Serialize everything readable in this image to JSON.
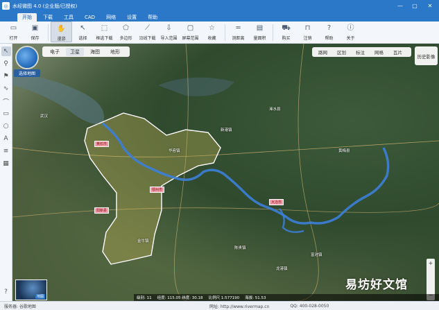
{
  "window": {
    "title": "水经微图 4.0 (企业版/已授权)",
    "controls": [
      "—",
      "▢",
      "✕"
    ]
  },
  "menus": [
    "开始",
    "下载",
    "工具",
    "CAD",
    "网络",
    "设置",
    "帮助"
  ],
  "toolbar": [
    {
      "label": "打开",
      "icon": "folder-icon"
    },
    {
      "label": "保存",
      "icon": "save-icon"
    },
    {
      "label": "漫游",
      "icon": "hand-icon"
    },
    {
      "label": "选择",
      "icon": "select-icon"
    },
    {
      "label": "框选下载",
      "icon": "box-download-icon"
    },
    {
      "label": "多边形",
      "icon": "polygon-icon"
    },
    {
      "label": "沿线下载",
      "icon": "line-download-icon"
    },
    {
      "label": "导入范围",
      "icon": "import-icon"
    },
    {
      "label": "屏幕范围",
      "icon": "screen-icon"
    },
    {
      "label": "收藏",
      "icon": "star-icon"
    },
    {
      "label": "测距离",
      "icon": "ruler-icon"
    },
    {
      "label": "量面积",
      "icon": "area-icon"
    },
    {
      "label": "购买",
      "icon": "cart-icon"
    },
    {
      "label": "注销",
      "icon": "lock-icon"
    },
    {
      "label": "帮助",
      "icon": "help-icon"
    },
    {
      "label": "关于",
      "icon": "info-icon"
    }
  ],
  "map": {
    "types": [
      "电子",
      "卫星",
      "海图",
      "地形"
    ],
    "layers": [
      "路网",
      "区划",
      "标注",
      "网格",
      "瓦片"
    ],
    "history_button": "历史影像",
    "globe_label": "选择地图",
    "overview_label": "地图",
    "watermark": "易坊好文馆",
    "region_labels": [
      "黄石市",
      "鄂州市",
      "大冶市",
      "阳新县"
    ],
    "place_labels": [
      "武汉",
      "华容镇",
      "新港镇",
      "金牛镇",
      "陈贵镇",
      "富池镇",
      "黄梅县",
      "龙港镇",
      "浠水县"
    ]
  },
  "coordbar": {
    "zoom": "级别: 11",
    "coord": "经度: 115.05  纬度: 30.18",
    "scale": "比例尺 1:577190",
    "alt": "海拔: 51.53"
  },
  "statusbar": {
    "left": "服务器: 谷歌地图",
    "center": "网址: http://www.rivermap.cn",
    "right": "QQ: 400-028-0050"
  },
  "colors": {
    "title_blue": "#2b78c8",
    "river": "#3c7fd8",
    "boundary": "#ffffff"
  }
}
